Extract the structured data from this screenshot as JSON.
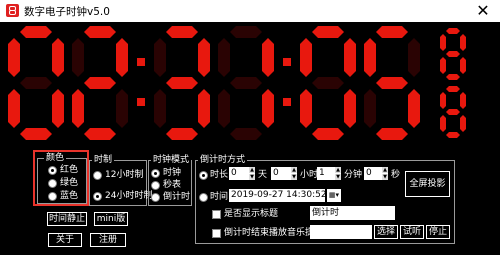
{
  "window": {
    "title": "数字电子时钟v5.0",
    "close_glyph": "✕"
  },
  "clock": {
    "hours": "02",
    "minutes": "31",
    "seconds": "05",
    "on_color": "#e8180e",
    "off_color": "#2a0303"
  },
  "color_group": {
    "title": "颜色",
    "options": [
      "红色",
      "绿色",
      "蓝色"
    ],
    "selected": 0
  },
  "hour_format_group": {
    "title": "时制",
    "options": [
      "12小时制",
      "24小时时制"
    ],
    "selected": 1
  },
  "mode_group": {
    "title": "时钟模式",
    "options": [
      "时钟",
      "秒表",
      "倒计时"
    ],
    "selected": 0
  },
  "countdown_group": {
    "title": "倒计时方式",
    "duration": {
      "label": "时长",
      "days": "0",
      "days_unit": "天",
      "hours": "0",
      "hours_unit": "小时",
      "minutes": "1",
      "minutes_unit": "分钟",
      "seconds": "0",
      "seconds_unit": "秒"
    },
    "target_time": {
      "label": "时间",
      "value": "2019-09-27  14:30:52"
    },
    "show_title": {
      "label": "是否显示标题",
      "value": "倒计时"
    },
    "play_music": {
      "label": "倒计时结束播放音乐提醒",
      "value": ""
    },
    "choose_label": "选择",
    "try_label": "试听",
    "stop_label": "停止",
    "fullscreen_label": "全屏投影"
  },
  "buttons": {
    "pause": "时间静止",
    "mini": "mini版",
    "about": "关于",
    "register": "注册"
  }
}
